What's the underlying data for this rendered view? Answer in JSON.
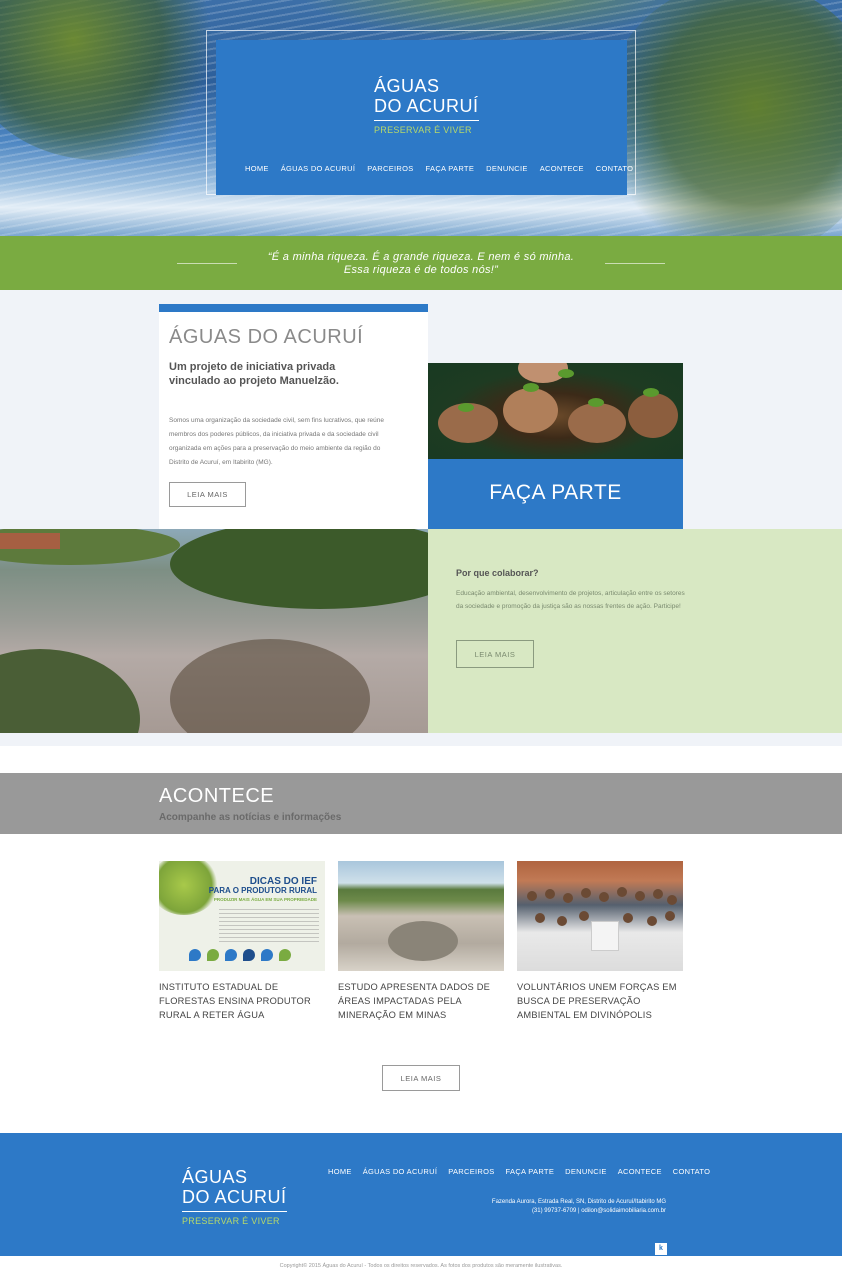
{
  "brand": {
    "line1": "ÁGUAS",
    "line2": "DO ACURUÍ",
    "tagline": "PRESERVAR É VIVER",
    "primary_color": "#2d79c7",
    "accent_color": "#7aab41"
  },
  "nav": [
    "HOME",
    "ÁGUAS DO ACURUÍ",
    "PARCEIROS",
    "FAÇA PARTE",
    "DENUNCIE",
    "ACONTECE",
    "CONTATO"
  ],
  "quote": {
    "line1": "“É a minha riqueza. É a grande riqueza. E nem é só minha.",
    "line2": "Essa riqueza é de todos nós!”"
  },
  "about": {
    "title": "ÁGUAS DO ACURUÍ",
    "subtitle": "Um projeto de iniciativa privada vinculado ao projeto Manuelzão.",
    "body": "Somos uma organização da sociedade civil, sem fins lucrativos, que reúne membros dos poderes públicos, da iniciativa privada e da sociedade civil organizada em ações para a preservação do meio ambiente da região do Distrito de Acuruí, em Itabirito (MG).",
    "button": "LEIA MAIS"
  },
  "faca_parte": {
    "title": "FAÇA PARTE",
    "question": "Por que colaborar?",
    "body": "Educação ambiental, desenvolvimento de projetos, articulação entre os setores da sociedade e promoção da justiça são as nossas frentes de ação. Participe!",
    "button": "LEIA MAIS"
  },
  "acontece": {
    "title": "ACONTECE",
    "subtitle": "Acompanhe as notícias e informações",
    "news": [
      {
        "title": "INSTITUTO ESTADUAL DE FLORESTAS ENSINA PRODUTOR RURAL A RETER ÁGUA",
        "image_text": [
          "DICAS DO IEF",
          "PARA O PRODUTOR RURAL",
          "PRODUZIR MAIS ÁGUA EM SUA PROPRIEDADE"
        ]
      },
      {
        "title": "ESTUDO APRESENTA DADOS DE ÁREAS IMPACTADAS PELA MINERAÇÃO EM MINAS"
      },
      {
        "title": "VOLUNTÁRIOS UNEM FORÇAS EM BUSCA DE PRESERVAÇÃO AMBIENTAL EM DIVINÓPOLIS"
      }
    ],
    "button": "LEIA MAIS"
  },
  "footer": {
    "address": "Fazenda Aurora, Estrada Real, SN, Distrito de Acuruí/Itabirito MG",
    "contact": "(31) 99737-6709 | odilon@solidaimobiliaria.com.br",
    "badge": "k",
    "copyright": "Copyright© 2015 Águas do Acuruí - Todos os direitos reservados. As fotos dos produtos são meramente ilustrativas."
  }
}
